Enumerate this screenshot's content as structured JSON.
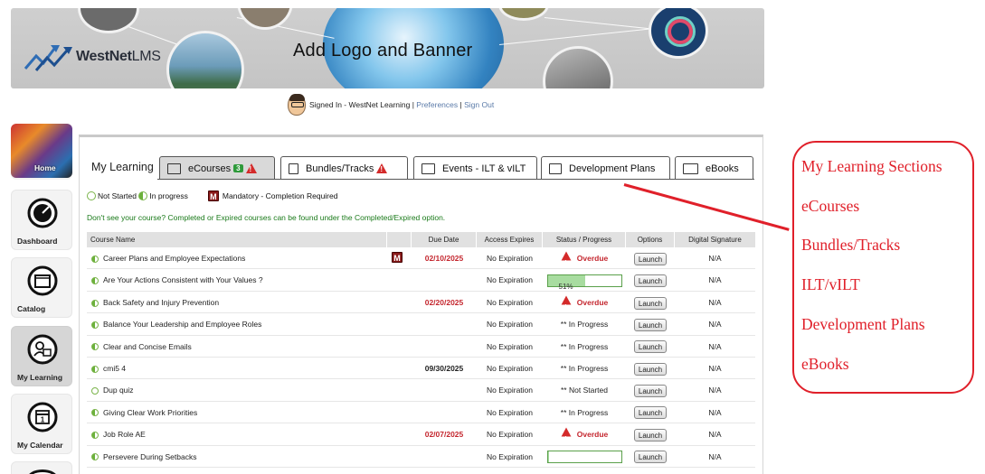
{
  "banner": {
    "logo_text": "WestNet",
    "logo_suffix": "LMS",
    "title": "Add Logo and Banner"
  },
  "signin": {
    "text": "Signed In - WestNet Learning |",
    "preferences": "Preferences",
    "separator": "|",
    "signout": "Sign Out"
  },
  "nav": {
    "items": [
      {
        "label": "Home"
      },
      {
        "label": "Dashboard"
      },
      {
        "label": "Catalog"
      },
      {
        "label": "My Learning"
      },
      {
        "label": "My Calendar"
      }
    ]
  },
  "main": {
    "section_title": "My Learning",
    "tabs": [
      {
        "label": "eCourses",
        "badge": "3"
      },
      {
        "label": "Bundles/Tracks"
      },
      {
        "label": "Events - ILT & vILT"
      },
      {
        "label": "Development Plans"
      },
      {
        "label": "eBooks"
      }
    ],
    "legend": {
      "not_started": "Not Started",
      "in_progress": "In progress",
      "mandatory_mark": "M",
      "mandatory": "Mandatory - Completion Required"
    },
    "notice": "Don't see your course? Completed or Expired courses can be found under the Completed/Expired option."
  },
  "table": {
    "headers": [
      "Course Name",
      "",
      "Due Date",
      "Access Expires",
      "Status / Progress",
      "Options",
      "Digital Signature"
    ],
    "launch_label": "Launch",
    "rows": [
      {
        "name": "Career Plans and Employee Expectations",
        "mandatory": "M",
        "due": "02/10/2025",
        "due_red": true,
        "expires": "No Expiration",
        "status": "Overdue",
        "status_type": "overdue",
        "signature": "N/A",
        "state": "half"
      },
      {
        "name": "Are Your Actions Consistent with Your Values ?",
        "mandatory": "",
        "due": "",
        "due_red": false,
        "expires": "No Expiration",
        "status": "51%",
        "progress": 51,
        "status_type": "progress",
        "signature": "N/A",
        "state": "half"
      },
      {
        "name": "Back Safety and Injury Prevention",
        "mandatory": "",
        "due": "02/20/2025",
        "due_red": true,
        "expires": "No Expiration",
        "status": "Overdue",
        "status_type": "overdue",
        "signature": "N/A",
        "state": "half"
      },
      {
        "name": "Balance Your Leadership and Employee Roles",
        "mandatory": "",
        "due": "",
        "due_red": false,
        "expires": "No Expiration",
        "status": "** In Progress",
        "status_type": "text",
        "signature": "N/A",
        "state": "half"
      },
      {
        "name": "Clear and Concise Emails",
        "mandatory": "",
        "due": "",
        "due_red": false,
        "expires": "No Expiration",
        "status": "** In Progress",
        "status_type": "text",
        "signature": "N/A",
        "state": "half"
      },
      {
        "name": "cmi5 4",
        "mandatory": "",
        "due": "09/30/2025",
        "due_red": false,
        "expires": "No Expiration",
        "status": "** In Progress",
        "status_type": "text",
        "signature": "N/A",
        "state": "half"
      },
      {
        "name": "Dup quiz",
        "mandatory": "",
        "due": "",
        "due_red": false,
        "expires": "No Expiration",
        "status": "** Not Started",
        "status_type": "text",
        "signature": "N/A",
        "state": "empty"
      },
      {
        "name": "Giving Clear Work Priorities",
        "mandatory": "",
        "due": "",
        "due_red": false,
        "expires": "No Expiration",
        "status": "** In Progress",
        "status_type": "text",
        "signature": "N/A",
        "state": "half"
      },
      {
        "name": "Job Role AE",
        "mandatory": "",
        "due": "02/07/2025",
        "due_red": true,
        "expires": "No Expiration",
        "status": "Overdue",
        "status_type": "overdue",
        "signature": "N/A",
        "state": "half"
      },
      {
        "name": "Persevere During Setbacks",
        "mandatory": "",
        "due": "",
        "due_red": false,
        "expires": "No Expiration",
        "status": "",
        "progress": 2,
        "status_type": "progress",
        "signature": "N/A",
        "state": "half"
      }
    ]
  },
  "annotation": {
    "items": [
      "My Learning Sections",
      "eCourses",
      "Bundles/Tracks",
      "ILT/vILT",
      "Development Plans",
      "eBooks"
    ],
    "color": "#e0202a"
  }
}
